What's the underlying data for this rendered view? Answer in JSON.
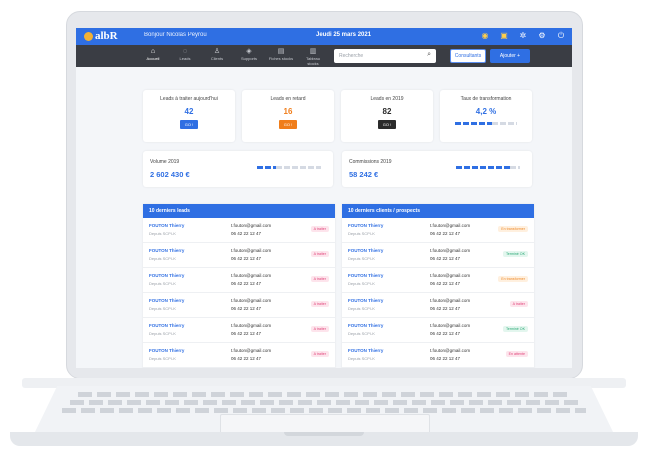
{
  "header": {
    "logo": "albR",
    "greeting": "Bonjour Nicolas Peyrou",
    "date": "Jeudi 25 mars 2021"
  },
  "nav": [
    {
      "label": "Accueil",
      "icon": "home-icon",
      "glyph": "⌂"
    },
    {
      "label": "Leads",
      "icon": "leads-icon",
      "glyph": "◌"
    },
    {
      "label": "Clients",
      "icon": "user-icon",
      "glyph": "♙"
    },
    {
      "label": "Supports",
      "icon": "cube-icon",
      "glyph": "◈"
    },
    {
      "label": "Fiches stocks",
      "icon": "document-icon",
      "glyph": "▤"
    },
    {
      "label": "Tableau stocks",
      "icon": "chart-icon",
      "glyph": "▥"
    },
    {
      "label": "Dashboards",
      "icon": "gauge-icon",
      "glyph": "◔"
    }
  ],
  "search": {
    "placeholder": "Recherche"
  },
  "buttons": {
    "consult": "Consultants",
    "add": "Ajouter  +"
  },
  "stats": [
    {
      "label": "Leads à traiter aujourd'hui",
      "value": "42",
      "button": "GO !",
      "color": "#2f6fe3"
    },
    {
      "label": "Leads en retard",
      "value": "16",
      "button": "GO !",
      "color": "#f07d1a"
    },
    {
      "label": "Leads en 2019",
      "value": "82",
      "button": "GO !",
      "color": "#2b2b2b"
    },
    {
      "label": "Taux de transformation",
      "value": "4,2 %",
      "progress": 0.6,
      "color": "#2f6fe3"
    }
  ],
  "wide": [
    {
      "label": "Volume 2019",
      "value": "2 602 430 €",
      "progress": 0.3
    },
    {
      "label": "Commissions 2019",
      "value": "58 242 €",
      "progress": 0.85
    }
  ],
  "leads_panel": {
    "title": "10 derniers leads",
    "rows": [
      {
        "name": "FOUTON Thierry",
        "sub": "Depuis SCPI-K",
        "email": "t.fouton@gmail.com",
        "phone": "06 42 22 12 47",
        "tag": "A traiter",
        "tone": "pink"
      },
      {
        "name": "FOUTON Thierry",
        "sub": "Depuis SCPI-K",
        "email": "t.fouton@gmail.com",
        "phone": "06 42 22 12 47",
        "tag": "A traiter",
        "tone": "pink"
      },
      {
        "name": "FOUTON Thierry",
        "sub": "Depuis SCPI-K",
        "email": "t.fouton@gmail.com",
        "phone": "06 42 22 12 47",
        "tag": "A traiter",
        "tone": "pink"
      },
      {
        "name": "FOUTON Thierry",
        "sub": "Depuis SCPI-K",
        "email": "t.fouton@gmail.com",
        "phone": "06 42 22 12 47",
        "tag": "A traiter",
        "tone": "pink"
      },
      {
        "name": "FOUTON Thierry",
        "sub": "Depuis SCPI-K",
        "email": "t.fouton@gmail.com",
        "phone": "06 42 22 12 47",
        "tag": "A traiter",
        "tone": "pink"
      },
      {
        "name": "FOUTON Thierry",
        "sub": "Depuis SCPI-K",
        "email": "t.fouton@gmail.com",
        "phone": "06 42 22 12 47",
        "tag": "A traiter",
        "tone": "pink"
      }
    ]
  },
  "clients_panel": {
    "title": "10 derniers clients / prospects",
    "rows": [
      {
        "name": "FOUTON Thierry",
        "sub": "Depuis SCPI-K",
        "email": "t.fouton@gmail.com",
        "phone": "06 42 22 12 47",
        "tag": "En transformer",
        "tone": "orange"
      },
      {
        "name": "FOUTON Thierry",
        "sub": "Depuis SCPI-K",
        "email": "t.fouton@gmail.com",
        "phone": "06 42 22 12 47",
        "tag": "Terminé OK",
        "tone": "green"
      },
      {
        "name": "FOUTON Thierry",
        "sub": "Depuis SCPI-K",
        "email": "t.fouton@gmail.com",
        "phone": "06 42 22 12 47",
        "tag": "En transformer",
        "tone": "orange"
      },
      {
        "name": "FOUTON Thierry",
        "sub": "Depuis SCPI-K",
        "email": "t.fouton@gmail.com",
        "phone": "06 42 22 12 47",
        "tag": "A traiter",
        "tone": "pink"
      },
      {
        "name": "FOUTON Thierry",
        "sub": "Depuis SCPI-K",
        "email": "t.fouton@gmail.com",
        "phone": "06 42 22 12 47",
        "tag": "Terminé OK",
        "tone": "green"
      },
      {
        "name": "FOUTON Thierry",
        "sub": "Depuis SCPI-K",
        "email": "t.fouton@gmail.com",
        "phone": "06 42 22 12 47",
        "tag": "En attente",
        "tone": "pink"
      }
    ]
  }
}
